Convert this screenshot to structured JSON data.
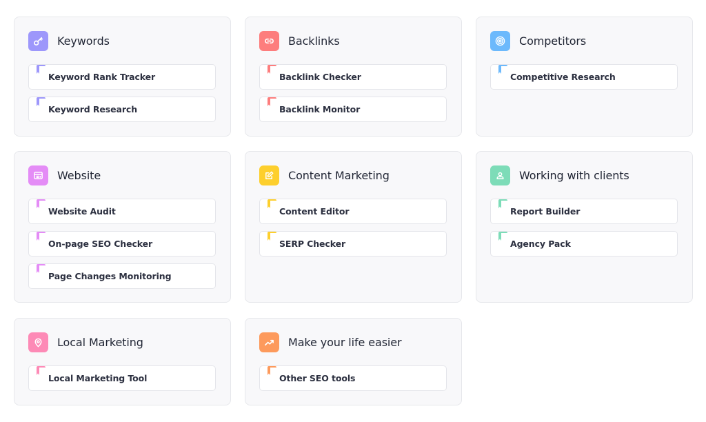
{
  "categories": [
    {
      "title": "Keywords",
      "icon": "key-icon",
      "color": "#9d97fb",
      "items": [
        "Keyword Rank Tracker",
        "Keyword Research"
      ]
    },
    {
      "title": "Backlinks",
      "icon": "link-icon",
      "color": "#fd7d7d",
      "items": [
        "Backlink Checker",
        "Backlink Monitor"
      ]
    },
    {
      "title": "Competitors",
      "icon": "target-icon",
      "color": "#6cb9fc",
      "items": [
        "Competitive Research"
      ]
    },
    {
      "title": "Website",
      "icon": "browser-icon",
      "color": "#e48cf6",
      "items": [
        "Website Audit",
        "On-page SEO Checker",
        "Page Changes Monitoring"
      ]
    },
    {
      "title": "Content Marketing",
      "icon": "edit-icon",
      "color": "#fdcf2d",
      "items": [
        "Content Editor",
        "SERP Checker"
      ]
    },
    {
      "title": "Working with clients",
      "icon": "user-icon",
      "color": "#7ddcb8",
      "items": [
        "Report Builder",
        "Agency Pack"
      ]
    },
    {
      "title": "Local Marketing",
      "icon": "location-pin-icon",
      "color": "#fd8ab6",
      "items": [
        "Local Marketing Tool"
      ]
    },
    {
      "title": "Make your life easier",
      "icon": "trending-up-icon",
      "color": "#fd9a5c",
      "items": [
        "Other SEO tools"
      ]
    }
  ]
}
